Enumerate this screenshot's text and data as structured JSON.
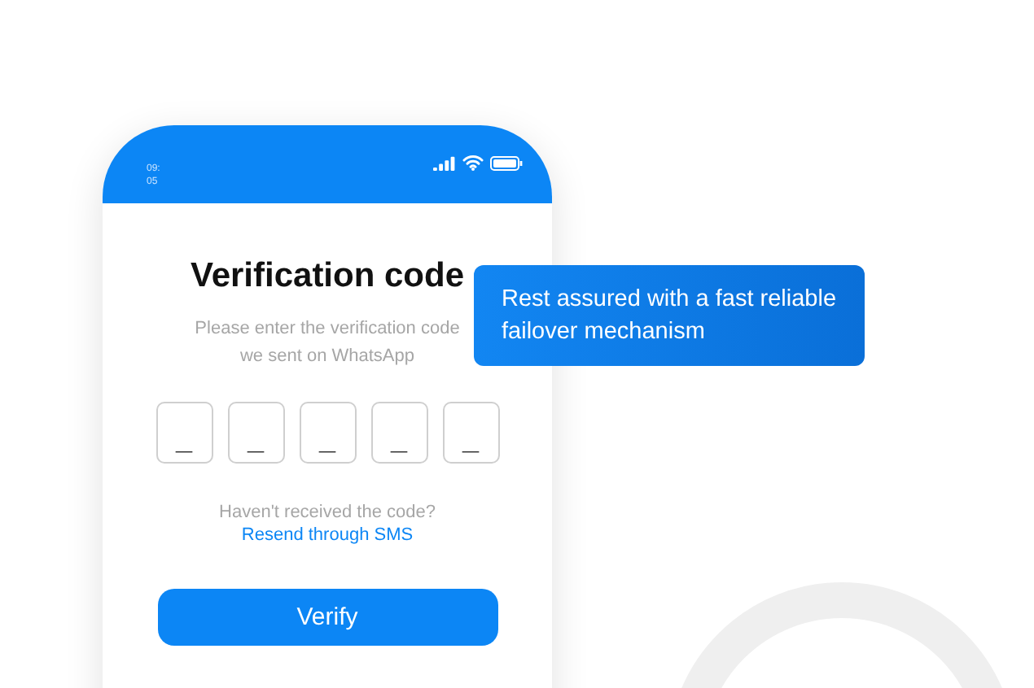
{
  "status_bar": {
    "time_lines": [
      "09:",
      "05"
    ]
  },
  "title": "Verification code",
  "subtitle_lines": [
    "Please enter the verification code",
    "we sent on WhatsApp"
  ],
  "code_fields": [
    {
      "placeholder": "_"
    },
    {
      "placeholder": "_"
    },
    {
      "placeholder": "_"
    },
    {
      "placeholder": "_"
    },
    {
      "placeholder": "_"
    }
  ],
  "resend_prompt": "Haven't received the code?",
  "resend_link": "Resend through SMS",
  "verify_button": "Verify",
  "callout": "Rest assured with a fast reliable failover mechanism"
}
